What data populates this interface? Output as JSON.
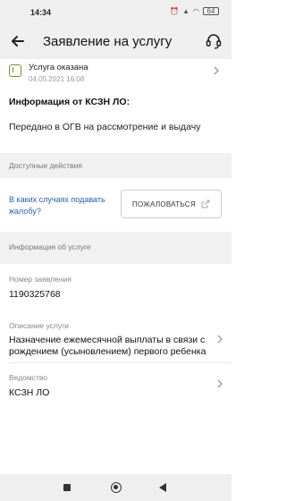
{
  "statusbar": {
    "time": "14:34",
    "battery": "64"
  },
  "header": {
    "title": "Заявление на услугу",
    "back_icon": "arrow-left-icon",
    "support_icon": "headset-icon"
  },
  "status": {
    "title": "Услуга оказана",
    "date": "04.05.2021 16:08",
    "from": "Информация от КСЗН ЛО:",
    "message": "Передано в ОГВ на рассмотрение и выдачу"
  },
  "actions": {
    "section_title": "Доступные действия",
    "help_link": "В каких случаях подавать жалобу?",
    "complain_button": "ПОЖАЛОВАТЬСЯ"
  },
  "service_info": {
    "section_title": "Информация об услуге",
    "number_label": "Номер заявления",
    "number_value": "1190325768",
    "description_label": "Описание услуги",
    "description_value": "Назначение ежемесячной выплаты в связи с рождением (усыновлением) первого ребенка",
    "department_label": "Ведомство",
    "department_value": "КСЗН ЛО"
  },
  "colors": {
    "link": "#2a5fab",
    "status_icon": "#6a9a2a",
    "section_bg": "#f1f1f1"
  }
}
